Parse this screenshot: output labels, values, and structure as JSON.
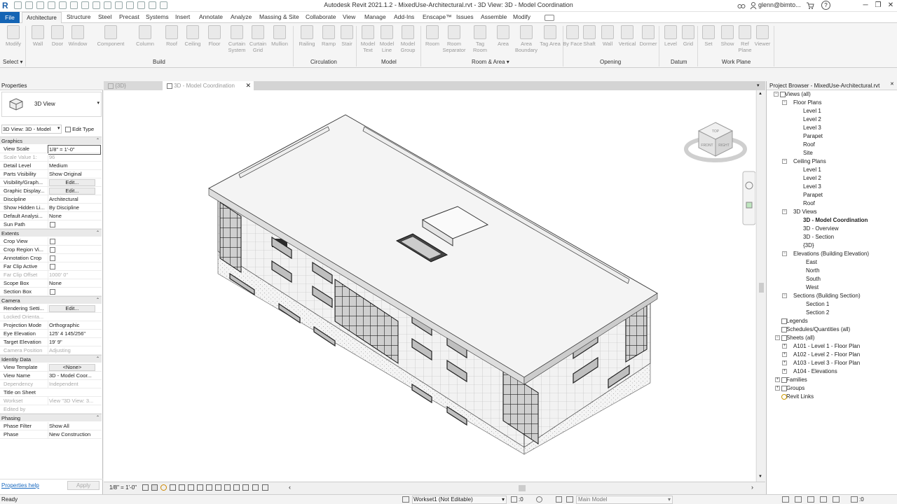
{
  "window": {
    "title": "Autodesk Revit 2021.1.2 - MixedUse-Architectural.rvt - 3D View: 3D - Model Coordination",
    "user": "glenn@bimto..."
  },
  "tabs": [
    "File",
    "Architecture",
    "Structure",
    "Steel",
    "Precast",
    "Systems",
    "Insert",
    "Annotate",
    "Analyze",
    "Massing & Site",
    "Collaborate",
    "View",
    "Manage",
    "Add-Ins",
    "Enscape™",
    "Issues",
    "Assemble",
    "Modify"
  ],
  "ribbon": {
    "tools": [
      {
        "label": "Modify",
        "icon": "cursor-icon"
      },
      {
        "label": "Wall",
        "icon": "wall-icon"
      },
      {
        "label": "Door",
        "icon": "door-icon"
      },
      {
        "label": "Window",
        "icon": "window-icon"
      },
      {
        "label": "Component",
        "icon": "component-icon"
      },
      {
        "label": "Column",
        "icon": "column-icon"
      },
      {
        "label": "Roof",
        "icon": "roof-icon"
      },
      {
        "label": "Ceiling",
        "icon": "ceiling-icon"
      },
      {
        "label": "Floor",
        "icon": "floor-icon"
      },
      {
        "label": "Curtain System",
        "icon": "curtain-system-icon"
      },
      {
        "label": "Curtain Grid",
        "icon": "curtain-grid-icon"
      },
      {
        "label": "Mullion",
        "icon": "mullion-icon"
      },
      {
        "label": "Railing",
        "icon": "railing-icon"
      },
      {
        "label": "Ramp",
        "icon": "ramp-icon"
      },
      {
        "label": "Stair",
        "icon": "stair-icon"
      },
      {
        "label": "Model Text",
        "icon": "model-text-icon"
      },
      {
        "label": "Model Line",
        "icon": "model-line-icon"
      },
      {
        "label": "Model Group",
        "icon": "model-group-icon"
      },
      {
        "label": "Room",
        "icon": "room-icon"
      },
      {
        "label": "Room Separator",
        "icon": "room-separator-icon"
      },
      {
        "label": "Tag Room",
        "icon": "tag-room-icon"
      },
      {
        "label": "Area",
        "icon": "area-icon"
      },
      {
        "label": "Area Boundary",
        "icon": "area-boundary-icon"
      },
      {
        "label": "Tag Area",
        "icon": "tag-area-icon"
      },
      {
        "label": "By Face",
        "icon": "by-face-icon"
      },
      {
        "label": "Shaft",
        "icon": "shaft-icon"
      },
      {
        "label": "Wall",
        "icon": "wall-opening-icon"
      },
      {
        "label": "Vertical",
        "icon": "vertical-icon"
      },
      {
        "label": "Dormer",
        "icon": "dormer-icon"
      },
      {
        "label": "Level",
        "icon": "level-icon"
      },
      {
        "label": "Grid",
        "icon": "grid-icon"
      },
      {
        "label": "Set",
        "icon": "set-icon"
      },
      {
        "label": "Show",
        "icon": "show-icon"
      },
      {
        "label": "Ref Plane",
        "icon": "ref-plane-icon"
      },
      {
        "label": "Viewer",
        "icon": "viewer-icon"
      }
    ],
    "panels": [
      "Select",
      "Build",
      "Circulation",
      "Model",
      "Room & Area",
      "Opening",
      "Datum",
      "Work Plane"
    ]
  },
  "properties": {
    "header": "Properties",
    "type_name": "3D View",
    "filter": "3D View: 3D - Model",
    "edit_type": "Edit Type",
    "groups": [
      {
        "name": "Graphics",
        "rows": [
          {
            "k": "View Scale",
            "v": "1/8\" = 1'-0\""
          },
          {
            "k": "Scale Value    1:",
            "v": "96",
            "dis": true
          },
          {
            "k": "Detail Level",
            "v": "Medium"
          },
          {
            "k": "Parts Visibility",
            "v": "Show Original"
          },
          {
            "k": "Visibility/Graph...",
            "v": "Edit...",
            "btn": true
          },
          {
            "k": "Graphic Display...",
            "v": "Edit...",
            "btn": true
          },
          {
            "k": "Discipline",
            "v": "Architectural"
          },
          {
            "k": "Show Hidden Li...",
            "v": "By Discipline"
          },
          {
            "k": "Default Analysi...",
            "v": "None"
          },
          {
            "k": "Sun Path",
            "v": "",
            "cb": true
          }
        ]
      },
      {
        "name": "Extents",
        "rows": [
          {
            "k": "Crop View",
            "v": "",
            "cb": true
          },
          {
            "k": "Crop Region Vi...",
            "v": "",
            "cb": true
          },
          {
            "k": "Annotation Crop",
            "v": "",
            "cb": true
          },
          {
            "k": "Far Clip Active",
            "v": "",
            "cb": true
          },
          {
            "k": "Far Clip Offset",
            "v": "1000' 0\"",
            "dis": true
          },
          {
            "k": "Scope Box",
            "v": "None"
          },
          {
            "k": "Section Box",
            "v": "",
            "cb": true
          }
        ]
      },
      {
        "name": "Camera",
        "rows": [
          {
            "k": "Rendering Setti...",
            "v": "Edit...",
            "btn": true
          },
          {
            "k": "Locked Orienta...",
            "v": "",
            "dis": true
          },
          {
            "k": "Projection Mode",
            "v": "Orthographic"
          },
          {
            "k": "Eye Elevation",
            "v": "125' 4 145/256\""
          },
          {
            "k": "Target Elevation",
            "v": "19' 9\""
          },
          {
            "k": "Camera Position",
            "v": "Adjusting",
            "dis": true
          }
        ]
      },
      {
        "name": "Identity Data",
        "rows": [
          {
            "k": "View Template",
            "v": "<None>",
            "btn": true
          },
          {
            "k": "View Name",
            "v": "3D - Model Coor..."
          },
          {
            "k": "Dependency",
            "v": "Independent",
            "dis": true
          },
          {
            "k": "Title on Sheet",
            "v": ""
          },
          {
            "k": "Workset",
            "v": "View \"3D View: 3...",
            "dis": true
          },
          {
            "k": "Edited by",
            "v": "",
            "dis": true
          }
        ]
      },
      {
        "name": "Phasing",
        "rows": [
          {
            "k": "Phase Filter",
            "v": "Show All"
          },
          {
            "k": "Phase",
            "v": "New Construction"
          }
        ]
      }
    ],
    "help": "Properties help",
    "apply": "Apply"
  },
  "view_tabs": [
    {
      "label": "{3D}"
    },
    {
      "label": "3D - Model Coordination"
    }
  ],
  "viewcube": {
    "top": "TOP",
    "front": "FRONT",
    "right": "RIGHT"
  },
  "view_control": {
    "scale": "1/8\" = 1'-0\""
  },
  "browser": {
    "header": "Project Browser - MixedUse-Architectural.rvt",
    "root": "Views (all)",
    "floor_plans": {
      "label": "Floor Plans",
      "items": [
        "Level 1",
        "Level 2",
        "Level 3",
        "Parapet",
        "Roof",
        "Site"
      ]
    },
    "ceiling_plans": {
      "label": "Ceiling Plans",
      "items": [
        "Level 1",
        "Level 2",
        "Level 3",
        "Parapet",
        "Roof"
      ]
    },
    "views_3d": {
      "label": "3D Views",
      "items": [
        "3D - Model Coordination",
        "3D - Overview",
        "3D - Section",
        "{3D}"
      ]
    },
    "elevations": {
      "label": "Elevations (Building Elevation)",
      "items": [
        "East",
        "North",
        "South",
        "West"
      ]
    },
    "sections": {
      "label": "Sections (Building Section)",
      "items": [
        "Section 1",
        "Section 2"
      ]
    },
    "legends": "Legends",
    "schedules": "Schedules/Quantities (all)",
    "sheets": {
      "label": "Sheets (all)",
      "items": [
        "A101 - Level 1 - Floor Plan",
        "A102 - Level 2 - Floor Plan",
        "A103 - Level 3 - Floor Plan",
        "A104 - Elevations"
      ]
    },
    "families": "Families",
    "groups": "Groups",
    "links": "Revit Links"
  },
  "status": {
    "text": "Ready",
    "workset": "Workset1 (Not Editable)",
    "counter": ":0",
    "model": "Main Model"
  }
}
